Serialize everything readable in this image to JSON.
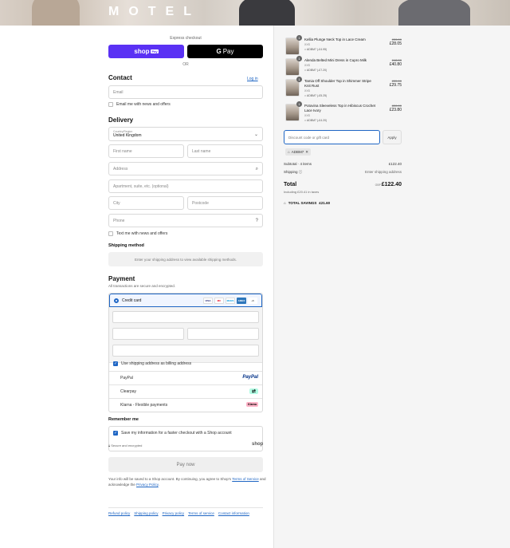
{
  "brand": {
    "logo": "MOTEL"
  },
  "express": {
    "label": "Express checkout",
    "shop_pay_label": "shop",
    "shop_pay_badge": "Pay",
    "gpay_label": "Pay",
    "or_label": "OR"
  },
  "contact": {
    "title": "Contact",
    "login_link": "Log in",
    "email_placeholder": "Email",
    "news_label": "Email me with news and offers"
  },
  "delivery": {
    "title": "Delivery",
    "country_label": "Country/Region",
    "country_value": "United Kingdom",
    "first_name": "First name",
    "last_name": "Last name",
    "address": "Address",
    "apartment": "Apartment, suite, etc. (optional)",
    "city": "City",
    "postcode": "Postcode",
    "phone": "Phone",
    "text_label": "Text me with news and offers"
  },
  "shipping_method": {
    "title": "Shipping method",
    "note": "Enter your shipping address to view available shipping methods."
  },
  "payment": {
    "title": "Payment",
    "subtitle": "All transactions are secure and encrypted.",
    "credit_card_label": "Credit card",
    "card_brands": [
      "VISA",
      "MC",
      "MAES",
      "AMEX",
      "+6"
    ],
    "billing_label": "Use shipping address as billing address",
    "methods": [
      {
        "label": "PayPal",
        "logo": "PayPal"
      },
      {
        "label": "Clearpay",
        "logo": "⇄"
      },
      {
        "label": "Klarna - Flexible payments",
        "logo": "Klarna"
      }
    ]
  },
  "remember": {
    "title": "Remember me",
    "save_label": "Save my information for a faster checkout with a Shop account",
    "secure_line": "Secure and encrypted",
    "shop_mark": "shop"
  },
  "pay_now": "Pay now",
  "legal": {
    "text": "Your info will be saved to a Shop account. By continuing, you agree to Shop's",
    "terms_link": "Terms of Service",
    "middle": "and acknowledge the",
    "privacy_link": "Privacy Policy",
    "end": "."
  },
  "footer_links": [
    "Refund policy",
    "Shipping policy",
    "Privacy policy",
    "Terms of service",
    "Contact information"
  ],
  "cart": {
    "items": [
      {
        "qty": "1",
        "name": "Kellia Plunge Neck Top in Lace Cream",
        "size": "XXS",
        "code": "ADBM7 (-£4.95)",
        "old_price": "£33.00",
        "price": "£28.05"
      },
      {
        "qty": "1",
        "name": "Alenda Belted Mini Dress in Cupro Milk",
        "size": "XXS",
        "code": "ADBM7 (-£7.20)",
        "old_price": "£48.00",
        "price": "£40.80"
      },
      {
        "qty": "1",
        "name": "Tamia Off Shoulder Top in Shimmer Stripe Knit Rust",
        "size": "XXS",
        "code": "ADBM7 (-£5.25)",
        "old_price": "£35.00",
        "price": "£29.75"
      },
      {
        "qty": "1",
        "name": "Potovina Sleeveless Top in Hibiscus Crochet Lace Ivory",
        "size": "XXS",
        "code": "ADBM7 (-£4.20)",
        "old_price": "£28.00",
        "price": "£23.80"
      }
    ],
    "discount_placeholder": "Discount code or gift card",
    "apply_label": "Apply",
    "applied_code": "ADBM7",
    "subtotal_label": "Subtotal · 4 items",
    "subtotal_value": "£122.40",
    "shipping_label": "Shipping",
    "shipping_value": "Enter shipping address",
    "total_label": "Total",
    "currency": "GBP",
    "total_value": "£122.40",
    "tax_line": "Including £20.41 in taxes",
    "savings_label": "TOTAL SAVINGS",
    "savings_value": "£21.60"
  },
  "colors": {
    "accent": "#1f66c4",
    "shop_purple": "#5a31f4",
    "panel_bg": "#f5f5f5"
  }
}
